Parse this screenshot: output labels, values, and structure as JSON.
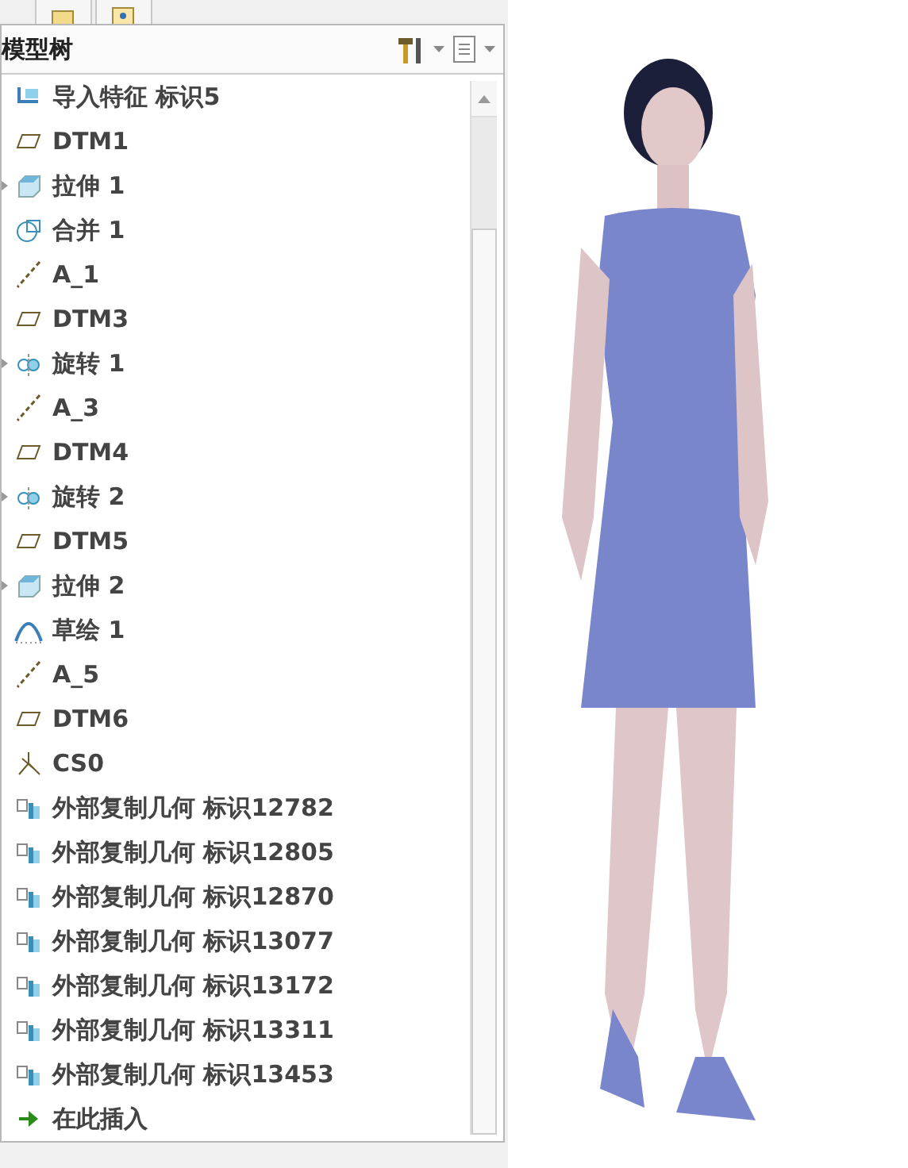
{
  "panel": {
    "title": "模型树"
  },
  "tree": [
    {
      "label": "导入特征 标识5",
      "kind": "import",
      "expandable": false
    },
    {
      "label": "DTM1",
      "kind": "plane",
      "expandable": false
    },
    {
      "label": "拉伸 1",
      "kind": "extrude",
      "expandable": true
    },
    {
      "label": "合并 1",
      "kind": "merge",
      "expandable": false
    },
    {
      "label": "A_1",
      "kind": "axis",
      "expandable": false
    },
    {
      "label": "DTM3",
      "kind": "plane",
      "expandable": false
    },
    {
      "label": "旋转 1",
      "kind": "revolve",
      "expandable": true
    },
    {
      "label": "A_3",
      "kind": "axis",
      "expandable": false
    },
    {
      "label": "DTM4",
      "kind": "plane",
      "expandable": false
    },
    {
      "label": "旋转 2",
      "kind": "revolve",
      "expandable": true
    },
    {
      "label": "DTM5",
      "kind": "plane",
      "expandable": false
    },
    {
      "label": "拉伸 2",
      "kind": "extrude",
      "expandable": true
    },
    {
      "label": "草绘 1",
      "kind": "sketch",
      "expandable": false
    },
    {
      "label": "A_5",
      "kind": "axis",
      "expandable": false
    },
    {
      "label": "DTM6",
      "kind": "plane",
      "expandable": false
    },
    {
      "label": "CS0",
      "kind": "csys",
      "expandable": false
    },
    {
      "label": "外部复制几何 标识12782",
      "kind": "copy",
      "expandable": false
    },
    {
      "label": "外部复制几何 标识12805",
      "kind": "copy",
      "expandable": false
    },
    {
      "label": "外部复制几何 标识12870",
      "kind": "copy",
      "expandable": false
    },
    {
      "label": "外部复制几何 标识13077",
      "kind": "copy",
      "expandable": false
    },
    {
      "label": "外部复制几何 标识13172",
      "kind": "copy",
      "expandable": false
    },
    {
      "label": "外部复制几何 标识13311",
      "kind": "copy",
      "expandable": false
    },
    {
      "label": "外部复制几何 标识13453",
      "kind": "copy",
      "expandable": false
    },
    {
      "label": "在此插入",
      "kind": "insert",
      "expandable": false
    }
  ]
}
